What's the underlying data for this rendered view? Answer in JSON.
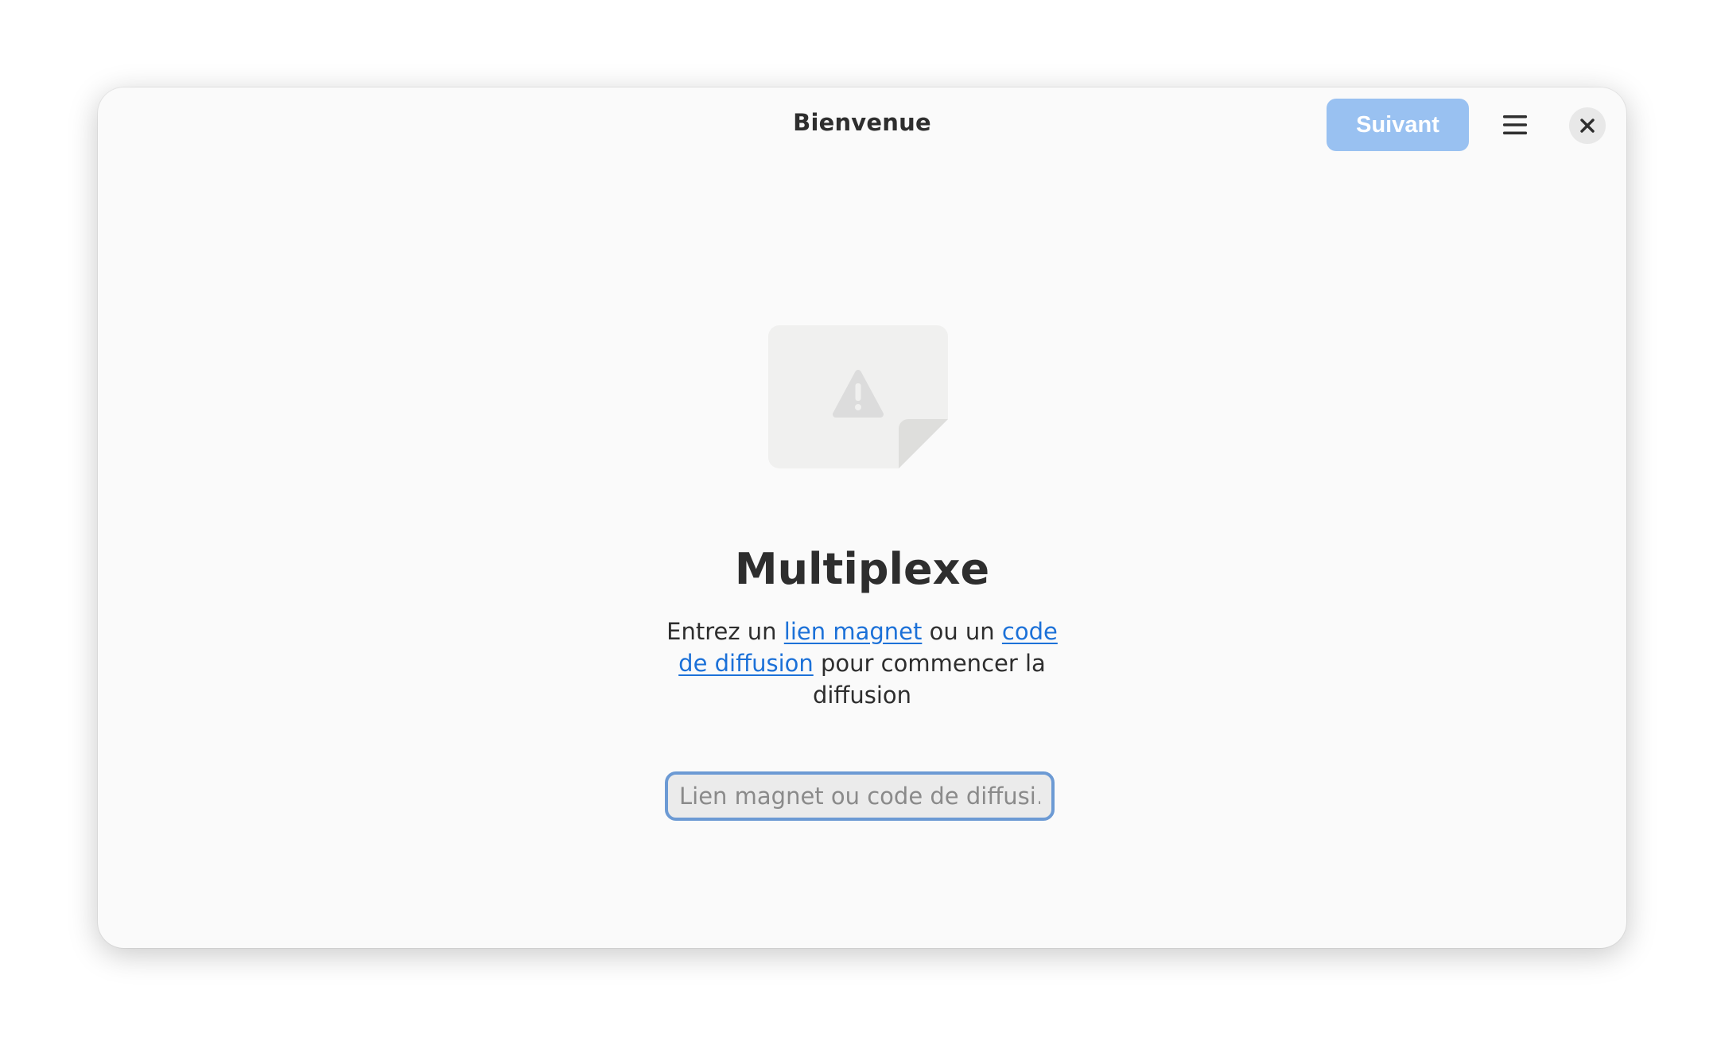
{
  "window": {
    "title": "Bienvenue"
  },
  "header": {
    "next_label": "Suivant",
    "menu_icon": "hamburger-menu-icon",
    "close_icon": "close-icon"
  },
  "status": {
    "icon": "missing-image-warning-icon",
    "title": "Multiplexe",
    "description": {
      "prefix": "Entrez un ",
      "link1": "lien magnet",
      "middle": " ou un ",
      "link2": "code de diffusion",
      "suffix": " pour commencer la diffusion"
    },
    "entry_placeholder": "Lien magnet ou code de diffusi…",
    "entry_value": ""
  },
  "colors": {
    "accent": "#99c1f1",
    "link": "#1c71d8",
    "focus_ring": "#6c9ad4",
    "window_bg": "#fafafa"
  }
}
